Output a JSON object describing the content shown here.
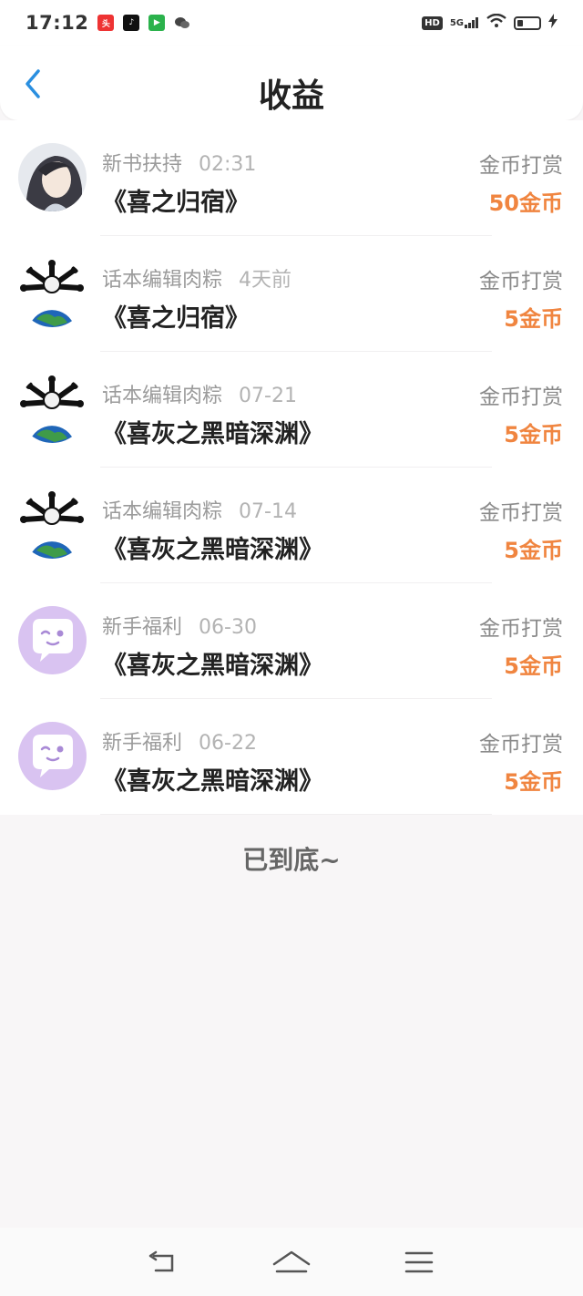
{
  "status_bar": {
    "time": "17:12",
    "notif_icons": [
      "toutiao-icon",
      "tiktok-icon",
      "iqiyi-icon",
      "wechat-icon"
    ],
    "hd": "HD",
    "network": "5G",
    "battery_level": 0.25
  },
  "header": {
    "title": "收益",
    "back_icon": "chevron-left-icon"
  },
  "records": [
    {
      "source": "新书扶持",
      "date": "02:31",
      "book": "《喜之归宿》",
      "type": "金币打赏",
      "amount": "50金币",
      "avatar": "anime-portrait"
    },
    {
      "source": "话本编辑肉粽",
      "date": "4天前",
      "book": "《喜之归宿》",
      "type": "金币打赏",
      "amount": "5金币",
      "avatar": "earth-meme"
    },
    {
      "source": "话本编辑肉粽",
      "date": "07-21",
      "book": "《喜灰之黑暗深渊》",
      "type": "金币打赏",
      "amount": "5金币",
      "avatar": "earth-meme"
    },
    {
      "source": "话本编辑肉粽",
      "date": "07-14",
      "book": "《喜灰之黑暗深渊》",
      "type": "金币打赏",
      "amount": "5金币",
      "avatar": "earth-meme"
    },
    {
      "source": "新手福利",
      "date": "06-30",
      "book": "《喜灰之黑暗深渊》",
      "type": "金币打赏",
      "amount": "5金币",
      "avatar": "chat-bubble"
    },
    {
      "source": "新手福利",
      "date": "06-22",
      "book": "《喜灰之黑暗深渊》",
      "type": "金币打赏",
      "amount": "5金币",
      "avatar": "chat-bubble"
    }
  ],
  "footer": {
    "end_text": "已到底~"
  },
  "nav": {
    "back_icon": "nav-back-icon",
    "home_icon": "nav-home-icon",
    "menu_icon": "nav-menu-icon"
  },
  "colors": {
    "accent_blue": "#2a8fe0",
    "coin_orange": "#f08540"
  }
}
